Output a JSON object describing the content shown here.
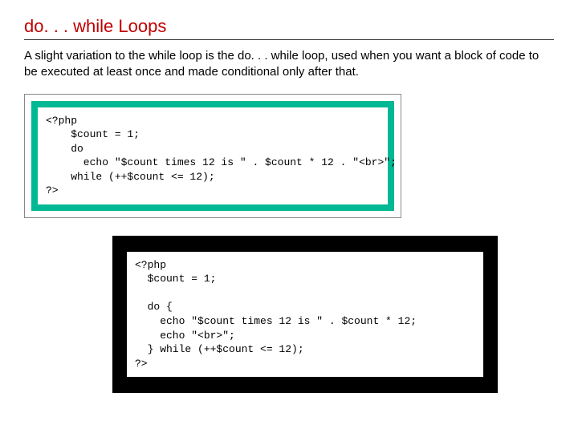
{
  "heading": "do. . . while Loops",
  "description": "A slight variation to the while loop is the do. . . while loop, used when you want a block of code to be executed at least once and made conditional only after that.",
  "code1": "<?php\n    $count = 1;\n    do\n      echo \"$count times 12 is \" . $count * 12 . \"<br>\";\n    while (++$count <= 12);\n?>",
  "code2": "<?php\n  $count = 1;\n\n  do {\n    echo \"$count times 12 is \" . $count * 12;\n    echo \"<br>\";\n  } while (++$count <= 12);\n?>"
}
